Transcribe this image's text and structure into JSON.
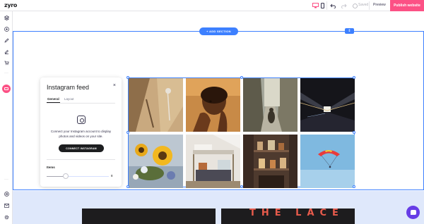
{
  "app": {
    "logo": "zyro"
  },
  "topbar": {
    "desktop_icon": "desktop-icon",
    "mobile_icon": "mobile-icon",
    "undo_icon": "undo-icon",
    "redo_icon": "redo-icon",
    "saved_label": "Saved",
    "preview_label": "Preview",
    "publish_label": "Publish website",
    "accent": "#fc5185"
  },
  "sidebar": {
    "items": [
      "layers-icon",
      "add-icon",
      "pen-icon",
      "edit-icon",
      "cart-icon",
      "more-icon",
      "instagram-feed-icon",
      "more-icon",
      "help-icon",
      "mail-icon",
      "settings-icon"
    ]
  },
  "canvas": {
    "add_section_label": "+ ADD SECTION",
    "section_handle": "⇕",
    "selection_color": "#3d80ff",
    "below_text": "THE LACE"
  },
  "gallery": {
    "images": [
      "Dried flower shadow on wall",
      "Portrait of woman with hands",
      "Alley with walking man",
      "Illuminated corridor",
      "Sunflowers bouquet",
      "Loft bed bedroom",
      "Shelves with jars",
      "Paraglider in blue sky"
    ]
  },
  "panel": {
    "title": "Instagram feed",
    "close": "×",
    "tabs": [
      "General",
      "Layout"
    ],
    "description": "Connect your Instagram account to display photos and videos on your site.",
    "connect_label": "CONNECT INSTAGRAM",
    "items_label": "Items",
    "items_value": "8"
  },
  "chat": {
    "icon": "chat-icon",
    "color": "#673de6"
  }
}
